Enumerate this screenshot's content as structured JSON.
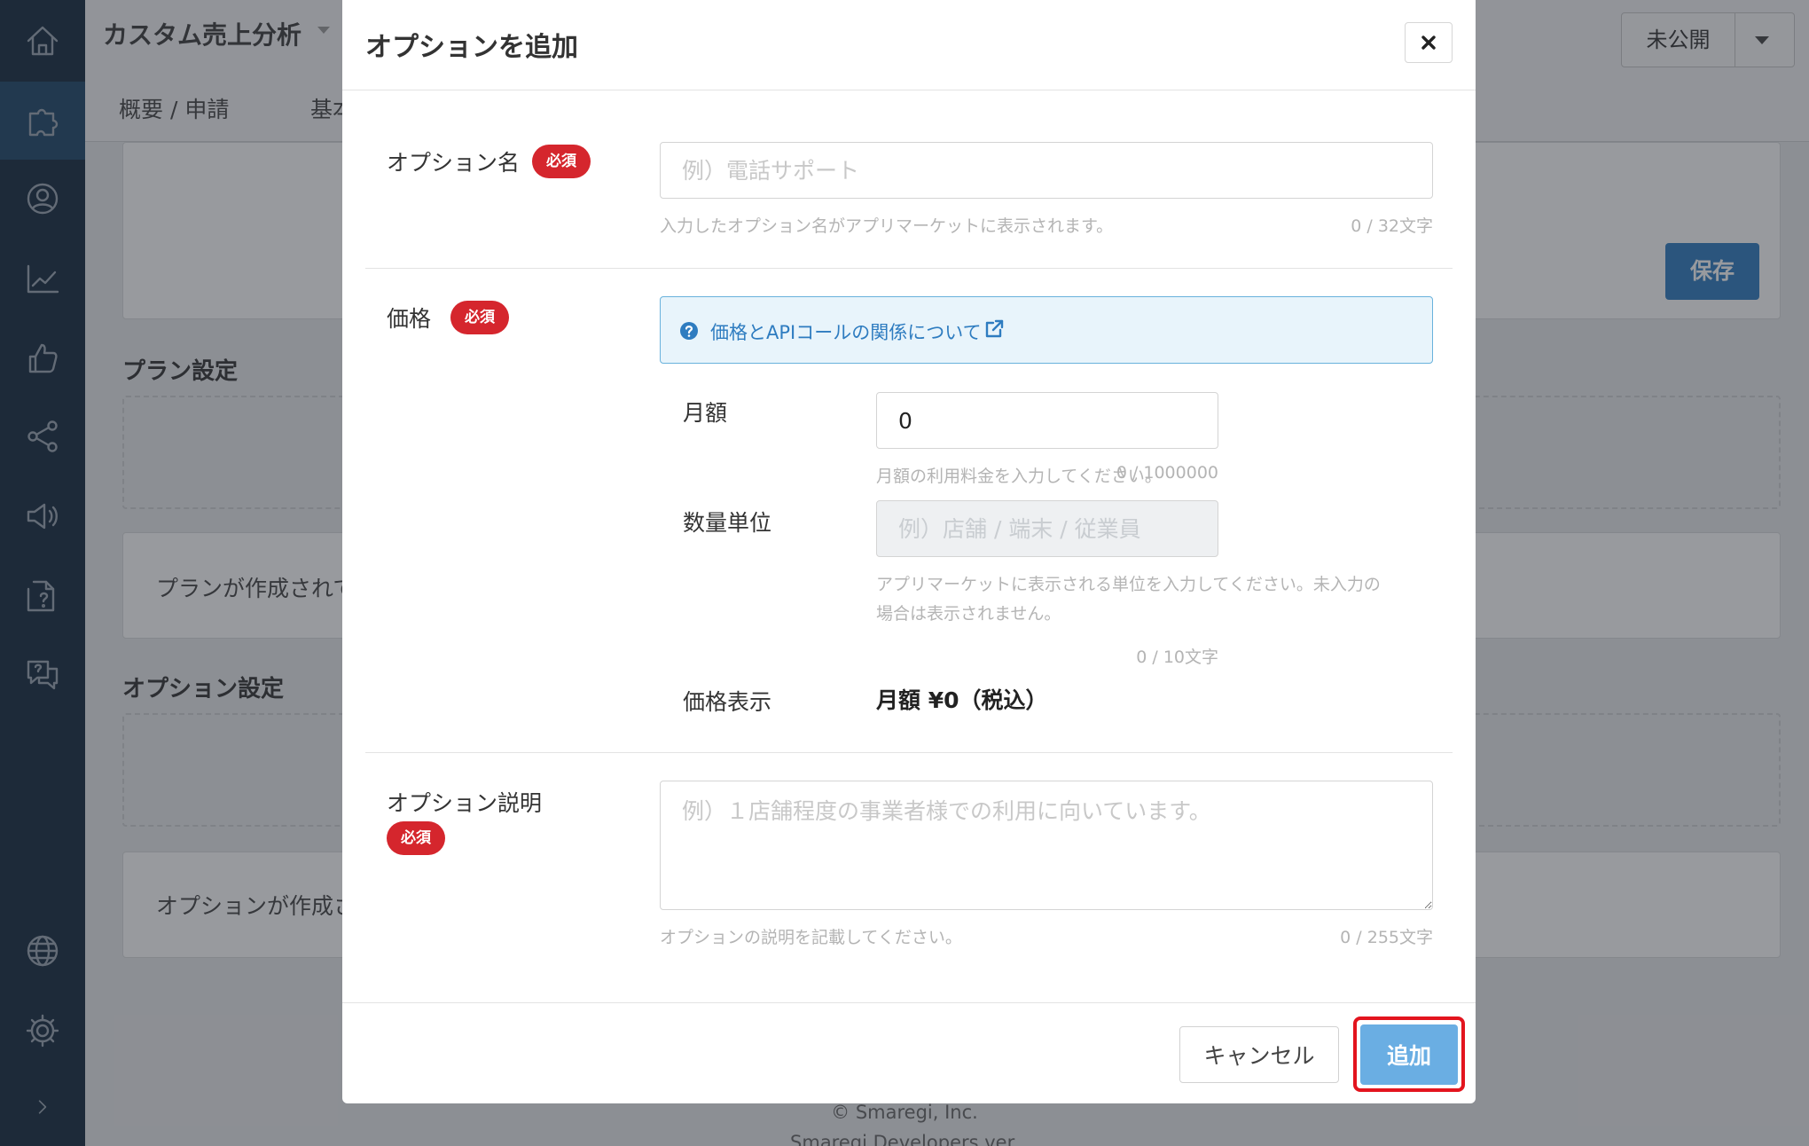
{
  "sidebar": {
    "items": [
      {
        "icon": "home-icon"
      },
      {
        "icon": "puzzle-icon",
        "active": true
      },
      {
        "icon": "user-icon"
      },
      {
        "icon": "chart-icon"
      },
      {
        "icon": "thumbs-up-icon"
      },
      {
        "icon": "share-icon"
      },
      {
        "icon": "megaphone-icon"
      },
      {
        "icon": "document-icon"
      },
      {
        "icon": "chat-icon"
      },
      {
        "icon": "globe-icon"
      },
      {
        "icon": "gear-icon"
      },
      {
        "icon": "chevron-right-icon"
      }
    ]
  },
  "header": {
    "app_title": "カスタム売上分析",
    "tabs": [
      "概要 / 申請",
      "基本"
    ],
    "status_label": "未公開"
  },
  "background": {
    "save_label": "保存",
    "plan_heading": "プラン設定",
    "plan_empty_text": "プランが作成されて",
    "option_heading": "オプション設定",
    "option_empty_text": "オプションが作成さ",
    "footer_copyright": "© Smaregi, Inc.",
    "footer_version": "Smaregi Developers ver."
  },
  "modal": {
    "title": "オプションを追加",
    "close_icon": "close-icon",
    "required_badge": "必須",
    "option_name": {
      "label": "オプション名",
      "value": "",
      "placeholder": "例）電話サポート",
      "hint": "入力したオプション名がアプリマーケットに表示されます。",
      "counter": "0 / 32文字"
    },
    "price": {
      "label": "価格",
      "info_link": "価格とAPIコールの関係について",
      "monthly_label": "月額",
      "monthly_value": "0",
      "monthly_hint": "月額の利用料金を入力してください。",
      "monthly_counter": "0 / 1000000",
      "unit_label": "数量単位",
      "unit_placeholder": "例）店舗 / 端末 / 従業員",
      "unit_hint_line1": "アプリマーケットに表示される単位を入力してください。未入力の",
      "unit_hint_line2": "場合は表示されません。",
      "unit_counter": "0 / 10文字",
      "display_label": "価格表示",
      "display_value": "月額 ¥0（税込）"
    },
    "description": {
      "label": "オプション説明",
      "value": "",
      "placeholder": "例）１店舗程度の事業者様での利用に向いています。",
      "hint": "オプションの説明を記載してください。",
      "counter": "0 / 255文字"
    },
    "cancel_label": "キャンセル",
    "add_label": "追加"
  },
  "colors": {
    "sidebar_bg": "#142a3f",
    "sidebar_active": "#1d4668",
    "required_red": "#d5262d",
    "link_blue": "#2e7cc0",
    "add_button": "#6aaee3",
    "highlight_red": "#e3141e"
  }
}
